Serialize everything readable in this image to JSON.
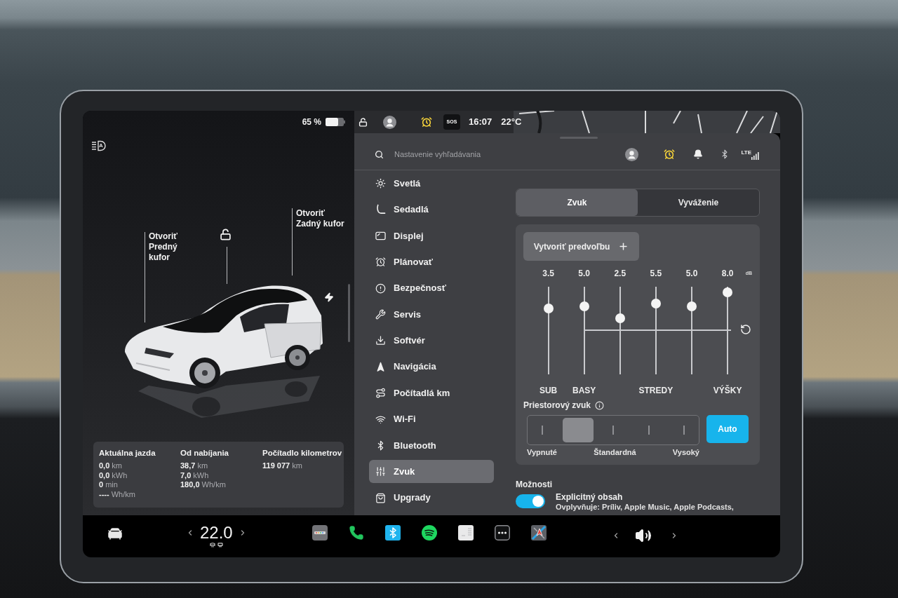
{
  "left_panel": {
    "battery_percent": "65 %",
    "headlights_mode": "A",
    "car": {
      "locked": false,
      "front_trunk": "Otvoriť\nPredný\nkufor",
      "rear_trunk": "Otvoriť\nZadný kufor"
    },
    "trip_stats": [
      {
        "title": "Aktuálna jazda",
        "rows": [
          {
            "value": "0,0",
            "unit": "km"
          },
          {
            "value": "0,0",
            "unit": "kWh"
          },
          {
            "value": "0",
            "unit": "min"
          },
          {
            "value": "----",
            "unit": "Wh/km"
          }
        ]
      },
      {
        "title": "Od nabíjania",
        "rows": [
          {
            "value": "38,7",
            "unit": "km"
          },
          {
            "value": "7,0",
            "unit": "kWh"
          },
          {
            "value": "180,0",
            "unit": "Wh/km"
          }
        ]
      },
      {
        "title": "Počítadlo kilometrov",
        "rows": [
          {
            "value": "119 077",
            "unit": "km"
          }
        ]
      }
    ]
  },
  "status_bar": {
    "locked": false,
    "sos": "SOS",
    "time": "16:07",
    "temperature": "22°C"
  },
  "settings": {
    "search": {
      "placeholder": "Nastavenie vyhľadávania"
    },
    "network": "LTE",
    "menu": [
      {
        "label": "Svetlá",
        "selected": false
      },
      {
        "label": "Sedadlá",
        "selected": false
      },
      {
        "label": "Displej",
        "selected": false
      },
      {
        "label": "Plánovať",
        "selected": false
      },
      {
        "label": "Bezpečnosť",
        "selected": false
      },
      {
        "label": "Servis",
        "selected": false
      },
      {
        "label": "Softvér",
        "selected": false
      },
      {
        "label": "Navigácia",
        "selected": false
      },
      {
        "label": "Počítadlá km",
        "selected": false
      },
      {
        "label": "Wi-Fi",
        "selected": false
      },
      {
        "label": "Bluetooth",
        "selected": false
      },
      {
        "label": "Zvuk",
        "selected": true
      },
      {
        "label": "Upgrady",
        "selected": false
      }
    ],
    "tabs": [
      {
        "label": "Zvuk",
        "selected": true
      },
      {
        "label": "Vyváženie",
        "selected": false
      }
    ],
    "equalizer": {
      "preset_button": "Vytvoriť predvoľbu",
      "unit": "dB",
      "bands": [
        {
          "value": "3.5",
          "level": 0.75,
          "label": "SUB"
        },
        {
          "value": "5.0",
          "level": 0.78,
          "label": "BASY"
        },
        {
          "value": "2.5",
          "level": 0.64
        },
        {
          "value": "5.5",
          "level": 0.81,
          "label": "STREDY"
        },
        {
          "value": "5.0",
          "level": 0.78
        },
        {
          "value": "8.0",
          "level": 0.94,
          "label": "VÝŠKY"
        }
      ]
    },
    "surround": {
      "label": "Priestorový zvuk",
      "level": 0.25,
      "marks": [
        "Vypnuté",
        "Štandardná",
        "Vysoký"
      ],
      "auto": {
        "label": "Auto",
        "on": true
      }
    },
    "options": {
      "title": "Možnosti",
      "items": [
        {
          "label": "Explicitný obsah",
          "description": "Ovplyvňuje: Príliv, Apple Music, Apple Podcasts,",
          "on": true
        }
      ]
    }
  },
  "bottom_bar": {
    "cabin_temperature": "22.0"
  }
}
